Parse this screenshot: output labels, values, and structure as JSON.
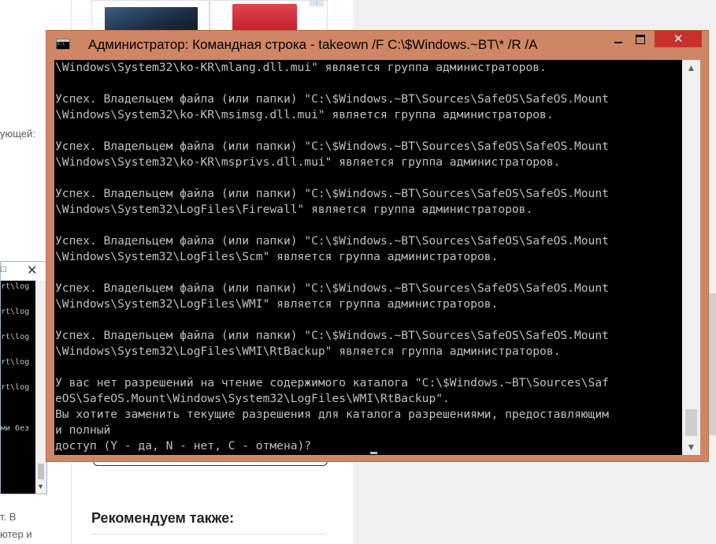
{
  "background_page": {
    "left_fragments": [
      "ующей:",
      "т. В",
      "ютер и"
    ],
    "heading": "Рекомендуем также:",
    "ad_badge": "i",
    "mini_console": {
      "lines": [
        "rt\\log",
        "rt\\log",
        "rt\\log",
        "rt\\log",
        "rt\\log",
        "ми без"
      ],
      "max_icon": "□",
      "close_icon": "✕"
    }
  },
  "window": {
    "title": "Администратор: Командная строка - takeown  /F C:\\$Windows.~BT\\* /R /A",
    "close_label": "✕",
    "scroll_up": "▲",
    "scroll_down": "▼"
  },
  "console_lines": [
    "\\Windows\\System32\\ko-KR\\mlang.dll.mui\" является группа администраторов.",
    "",
    "Успех. Владельцем файла (или папки) \"C:\\$Windows.~BT\\Sources\\SafeOS\\SafeOS.Mount",
    "\\Windows\\System32\\ko-KR\\msimsg.dll.mui\" является группа администраторов.",
    "",
    "Успех. Владельцем файла (или папки) \"C:\\$Windows.~BT\\Sources\\SafeOS\\SafeOS.Mount",
    "\\Windows\\System32\\ko-KR\\msprivs.dll.mui\" является группа администраторов.",
    "",
    "Успех. Владельцем файла (или папки) \"C:\\$Windows.~BT\\Sources\\SafeOS\\SafeOS.Mount",
    "\\Windows\\System32\\LogFiles\\Firewall\" является группа администраторов.",
    "",
    "Успех. Владельцем файла (или папки) \"C:\\$Windows.~BT\\Sources\\SafeOS\\SafeOS.Mount",
    "\\Windows\\System32\\LogFiles\\Scm\" является группа администраторов.",
    "",
    "Успех. Владельцем файла (или папки) \"C:\\$Windows.~BT\\Sources\\SafeOS\\SafeOS.Mount",
    "\\Windows\\System32\\LogFiles\\WMI\" является группа администраторов.",
    "",
    "Успех. Владельцем файла (или папки) \"C:\\$Windows.~BT\\Sources\\SafeOS\\SafeOS.Mount",
    "\\Windows\\System32\\LogFiles\\WMI\\RtBackup\" является группа администраторов.",
    "",
    "У вас нет разрешений на чтение содержимого каталога \"C:\\$Windows.~BT\\Sources\\Saf",
    "eOS\\SafeOS.Mount\\Windows\\System32\\LogFiles\\WMI\\RtBackup\".",
    "Вы хотите заменить текущие разрешения для каталога разрешениями, предоставляющим",
    "и полный",
    "доступ (Y -  да, N - нет, C - отмена)? "
  ]
}
